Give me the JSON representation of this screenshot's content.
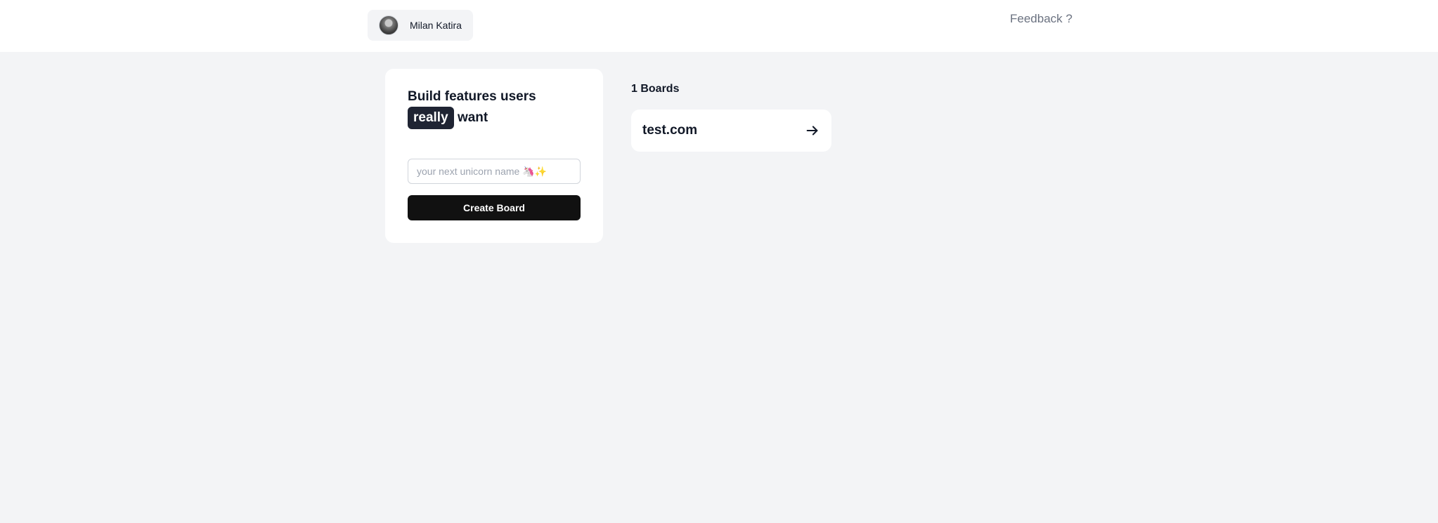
{
  "header": {
    "user_name": "Milan Katira",
    "feedback_label": "Feedback ?"
  },
  "create_card": {
    "headline_part1": "Build features users",
    "headline_highlight": "really",
    "headline_part2": "want",
    "input_value": "",
    "input_placeholder": "your next unicorn name 🦄✨",
    "button_label": "Create Board"
  },
  "boards": {
    "count_label": "1 Boards",
    "items": [
      {
        "name": "test.com",
        "icon": "arrow-right-icon"
      }
    ]
  }
}
